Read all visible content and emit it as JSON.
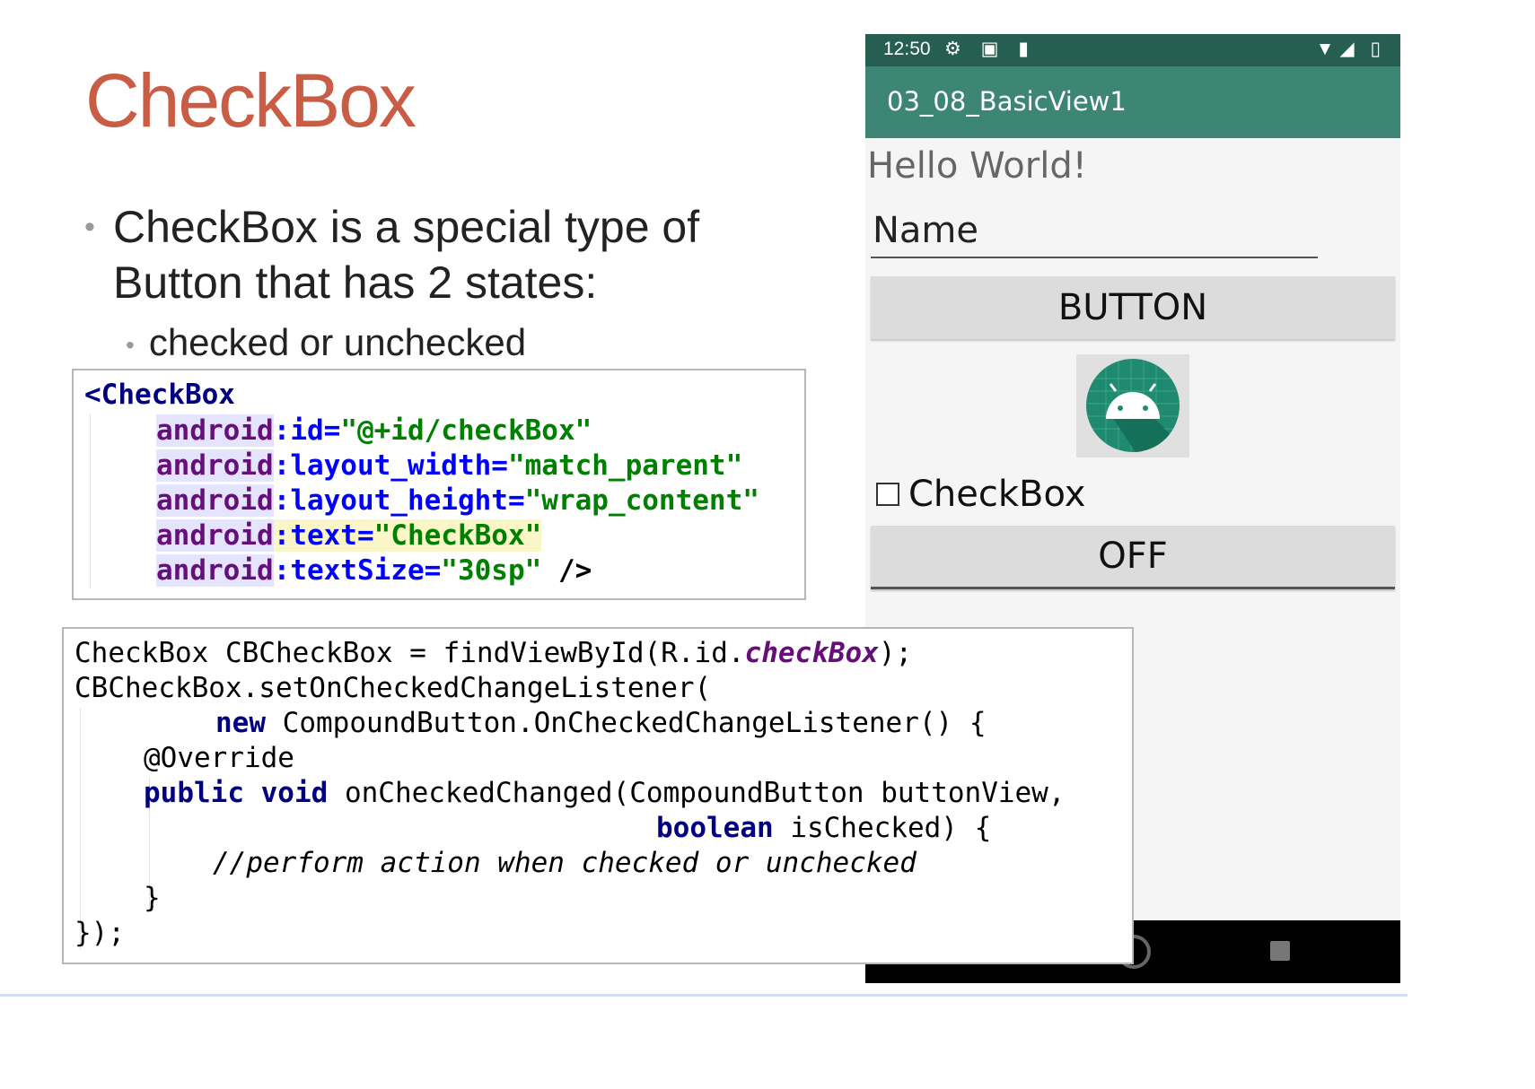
{
  "slide": {
    "title": "CheckBox",
    "bullet1_line1": "CheckBox is a special type of",
    "bullet1_line2": "Button that has 2 states:",
    "bullet2": "checked or unchecked",
    "bullet_glyph": "•"
  },
  "xml_code": {
    "open_tag": "<CheckBox",
    "ns": "android",
    "lines": [
      {
        "attr": ":id=",
        "val": "\"@+id/checkBox\""
      },
      {
        "attr": ":layout_width=",
        "val": "\"match_parent\""
      },
      {
        "attr": ":layout_height=",
        "val": "\"wrap_content\""
      },
      {
        "attr": ":text=",
        "val": "\"CheckBox\""
      },
      {
        "attr": ":textSize=",
        "val": "\"30sp\"",
        "close": " />"
      }
    ]
  },
  "phone": {
    "status_time": "12:50",
    "status_icons": "⚙ ▣ ▮",
    "status_right": "▼◢ ▯",
    "app_title": "03_08_BasicView1",
    "hello_text": "Hello World!",
    "name_hint": "Name",
    "button_label": "BUTTON",
    "checkbox_label": "CheckBox",
    "checkbox_checked": false,
    "toggle_label": "OFF",
    "image_icon": "android-robot-icon"
  },
  "java_code": {
    "l1_a": "CheckBox CBCheckBox = findViewById(R.id.",
    "l1_field": "checkBox",
    "l1_b": ");",
    "l2": "CBCheckBox.setOnCheckedChangeListener(",
    "l3_kw": "new",
    "l3_rest": " CompoundButton.OnCheckedChangeListener() {",
    "l4": "@Override",
    "l5_kw": "public void",
    "l5_rest": " onCheckedChanged(CompoundButton buttonView,",
    "l6_kw": "boolean",
    "l6_rest": " isChecked) {",
    "l7": "//perform action when checked or unchecked",
    "l8": "}",
    "l9": "});"
  },
  "colors": {
    "title": "#c95c44",
    "status_bar": "#265e51",
    "app_bar": "#3d8574"
  }
}
